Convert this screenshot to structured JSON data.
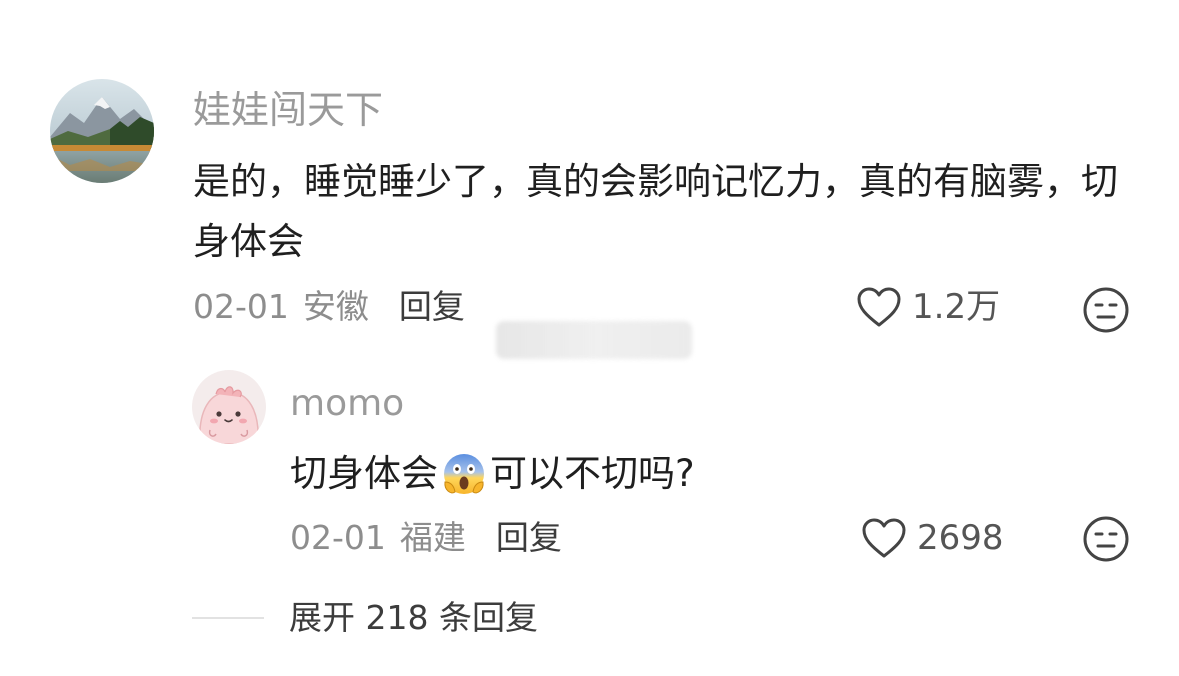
{
  "comment": {
    "username": "娃娃闯天下",
    "text": "是的，睡觉睡少了，真的会影响记忆力，真的有脑雾，切身体会",
    "date": "02-01",
    "location": "安徽",
    "reply_label": "回复",
    "like_count": "1.2万",
    "avatar_icon": "landscape-avatar",
    "like_icon": "heart-outline-icon",
    "dislike_icon": "neutral-face-icon"
  },
  "reply": {
    "username": "momo",
    "text_before": "切身体会",
    "emoji": "face-screaming-in-fear",
    "text_after": "可以不切吗?",
    "date": "02-01",
    "location": "福建",
    "reply_label": "回复",
    "like_count": "2698",
    "avatar_icon": "pink-blob-avatar",
    "like_icon": "heart-outline-icon",
    "dislike_icon": "neutral-face-icon"
  },
  "expand": {
    "label": "展开 218 条回复"
  },
  "colors": {
    "text_primary": "#1f1f1f",
    "text_secondary": "#9a9a9a",
    "meta": "#8d8d8d",
    "icon_stroke": "#444444"
  }
}
